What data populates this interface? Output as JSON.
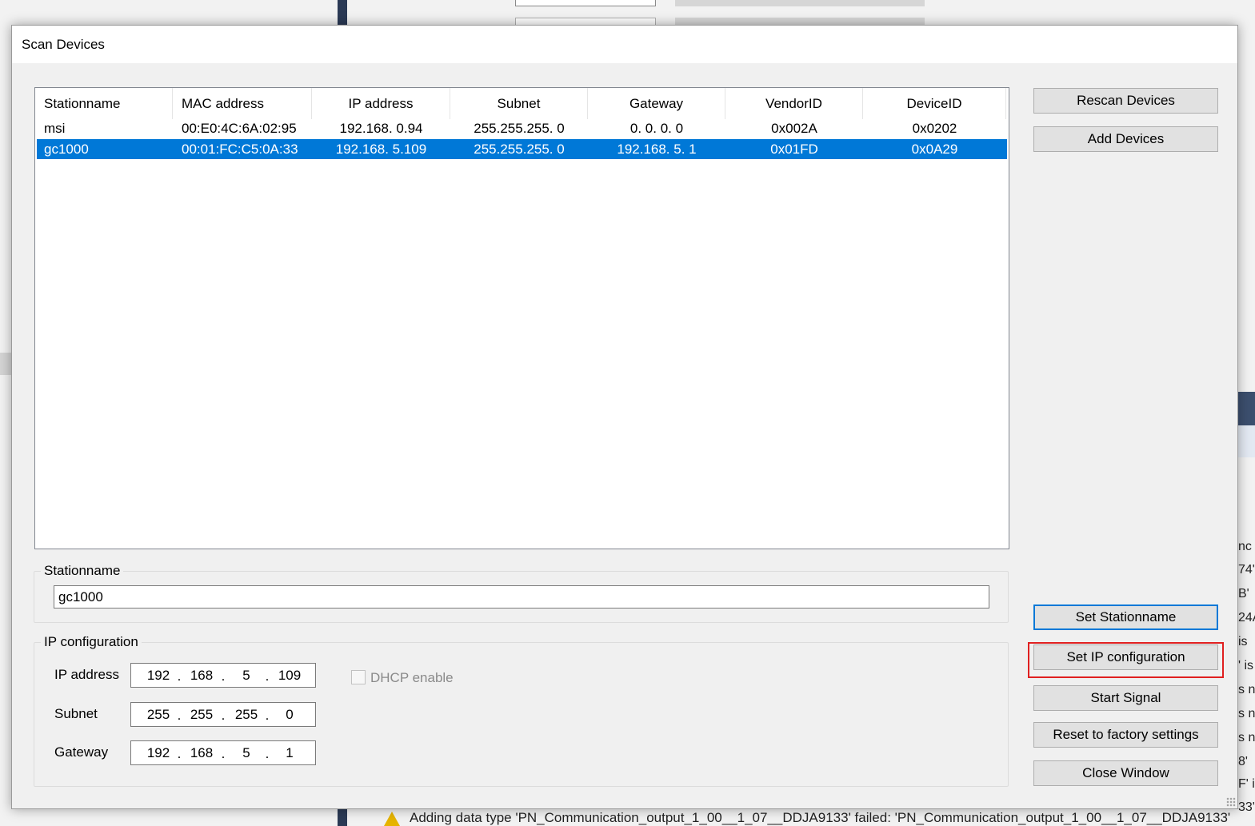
{
  "background": {
    "log_fragments": [
      "nc",
      "74'",
      "B'",
      "24A",
      "is",
      "' is",
      "s n",
      "s n",
      "s n",
      "8'",
      "F' i",
      "33'"
    ],
    "bottom_message": "Adding data type 'PN_Communication_output_1_00__1_07__DDJA9133' failed: 'PN_Communication_output_1_00__1_07__DDJA9133'"
  },
  "dialog": {
    "title": "Scan Devices"
  },
  "device_table": {
    "columns": [
      "Stationname",
      "MAC address",
      "IP address",
      "Subnet",
      "Gateway",
      "VendorID",
      "DeviceID"
    ],
    "rows": [
      {
        "stationname": "msi",
        "mac": "00:E0:4C:6A:02:95",
        "ip": "192.168. 0.94",
        "subnet": "255.255.255. 0",
        "gateway": "0. 0. 0. 0",
        "vendor_id": "0x002A",
        "device_id": "0x0202",
        "selected": false
      },
      {
        "stationname": "gc1000",
        "mac": "00:01:FC:C5:0A:33",
        "ip": "192.168. 5.109",
        "subnet": "255.255.255. 0",
        "gateway": "192.168. 5. 1",
        "vendor_id": "0x01FD",
        "device_id": "0x0A29",
        "selected": true
      }
    ]
  },
  "stationname_group": {
    "legend": "Stationname",
    "value": "gc1000"
  },
  "ip_group": {
    "legend": "IP configuration",
    "ip_label": "IP address",
    "ip": [
      "192",
      "168",
      "5",
      "109"
    ],
    "subnet_label": "Subnet",
    "subnet": [
      "255",
      "255",
      "255",
      "0"
    ],
    "gateway_label": "Gateway",
    "gateway": [
      "192",
      "168",
      "5",
      "1"
    ],
    "dhcp_label": "DHCP enable",
    "dhcp_checked": false
  },
  "buttons": {
    "rescan": "Rescan Devices",
    "add": "Add Devices",
    "set_stationname": "Set Stationname",
    "set_ip": "Set IP configuration",
    "start_signal": "Start Signal",
    "reset": "Reset to factory settings",
    "close": "Close Window"
  },
  "colors": {
    "selection": "#0078d7",
    "highlight_frame": "#e02020"
  }
}
